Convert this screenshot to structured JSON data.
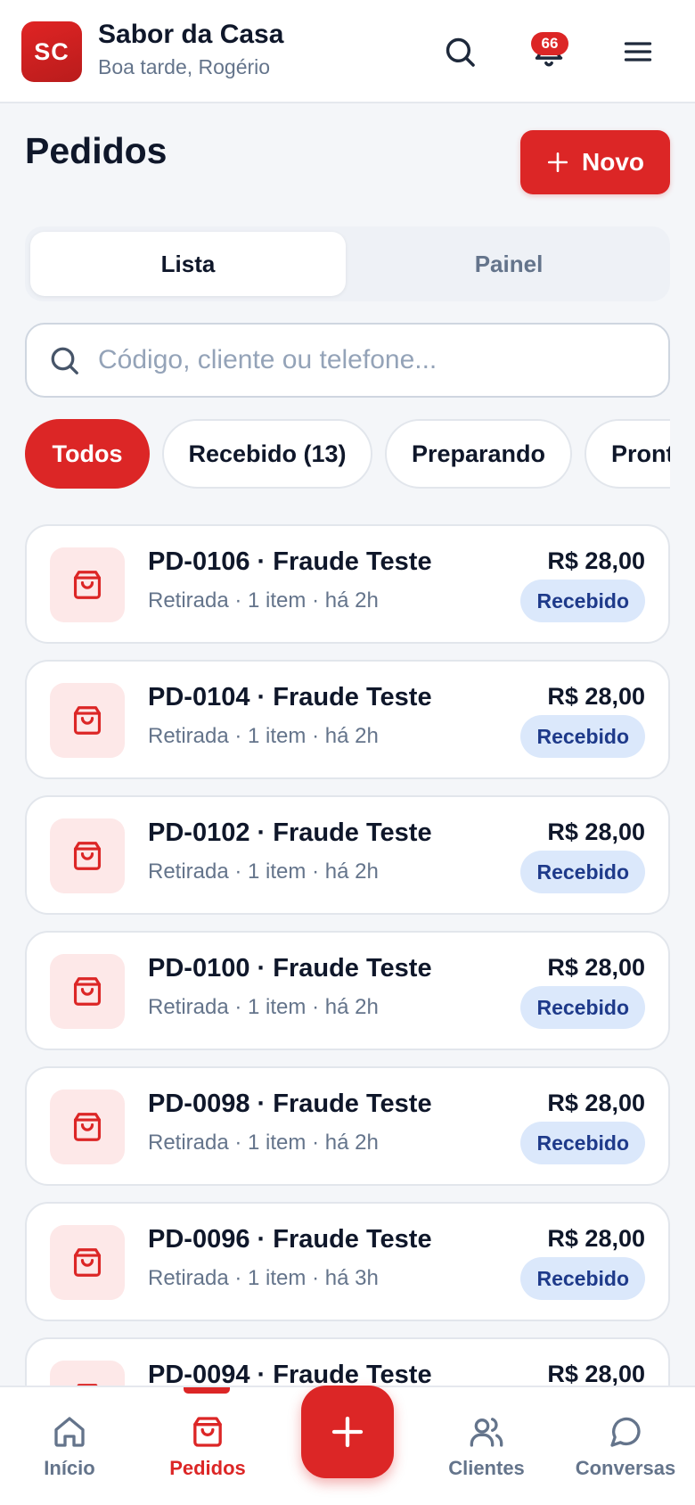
{
  "header": {
    "logo_text": "SC",
    "brand_name": "Sabor da Casa",
    "greeting": "Boa tarde, Rogério",
    "notification_count": "66"
  },
  "page": {
    "title": "Pedidos",
    "new_button_label": "Novo"
  },
  "view_tabs": [
    {
      "label": "Lista",
      "active": true
    },
    {
      "label": "Painel",
      "active": false
    }
  ],
  "search": {
    "placeholder": "Código, cliente ou telefone...",
    "value": ""
  },
  "filters": [
    {
      "label": "Todos",
      "active": true
    },
    {
      "label": "Recebido (13)",
      "active": false
    },
    {
      "label": "Preparando",
      "active": false
    },
    {
      "label": "Pronto",
      "active": false
    }
  ],
  "orders": [
    {
      "title": "PD-0106 · Fraude Teste",
      "meta": "Retirada · 1 item · há 2h",
      "price": "R$ 28,00",
      "status": "Recebido"
    },
    {
      "title": "PD-0104 · Fraude Teste",
      "meta": "Retirada · 1 item · há 2h",
      "price": "R$ 28,00",
      "status": "Recebido"
    },
    {
      "title": "PD-0102 · Fraude Teste",
      "meta": "Retirada · 1 item · há 2h",
      "price": "R$ 28,00",
      "status": "Recebido"
    },
    {
      "title": "PD-0100 · Fraude Teste",
      "meta": "Retirada · 1 item · há 2h",
      "price": "R$ 28,00",
      "status": "Recebido"
    },
    {
      "title": "PD-0098 · Fraude Teste",
      "meta": "Retirada · 1 item · há 2h",
      "price": "R$ 28,00",
      "status": "Recebido"
    },
    {
      "title": "PD-0096 · Fraude Teste",
      "meta": "Retirada · 1 item · há 3h",
      "price": "R$ 28,00",
      "status": "Recebido"
    },
    {
      "title": "PD-0094 · Fraude Teste",
      "meta": "",
      "price": "R$ 28,00",
      "status": ""
    }
  ],
  "bottom_nav": {
    "items": [
      {
        "label": "Início",
        "icon": "home-icon",
        "active": false
      },
      {
        "label": "Pedidos",
        "icon": "shopping-bag-icon",
        "active": true
      },
      {
        "label": "Clientes",
        "icon": "users-icon",
        "active": false
      },
      {
        "label": "Conversas",
        "icon": "chat-bubble-icon",
        "active": false
      }
    ],
    "fab_icon": "plus-icon"
  },
  "colors": {
    "accent": "#dc2626",
    "status_bg": "#dbe8fb",
    "status_text": "#1e3a8a",
    "muted_text": "#64748b",
    "page_bg": "#f4f6f9"
  }
}
